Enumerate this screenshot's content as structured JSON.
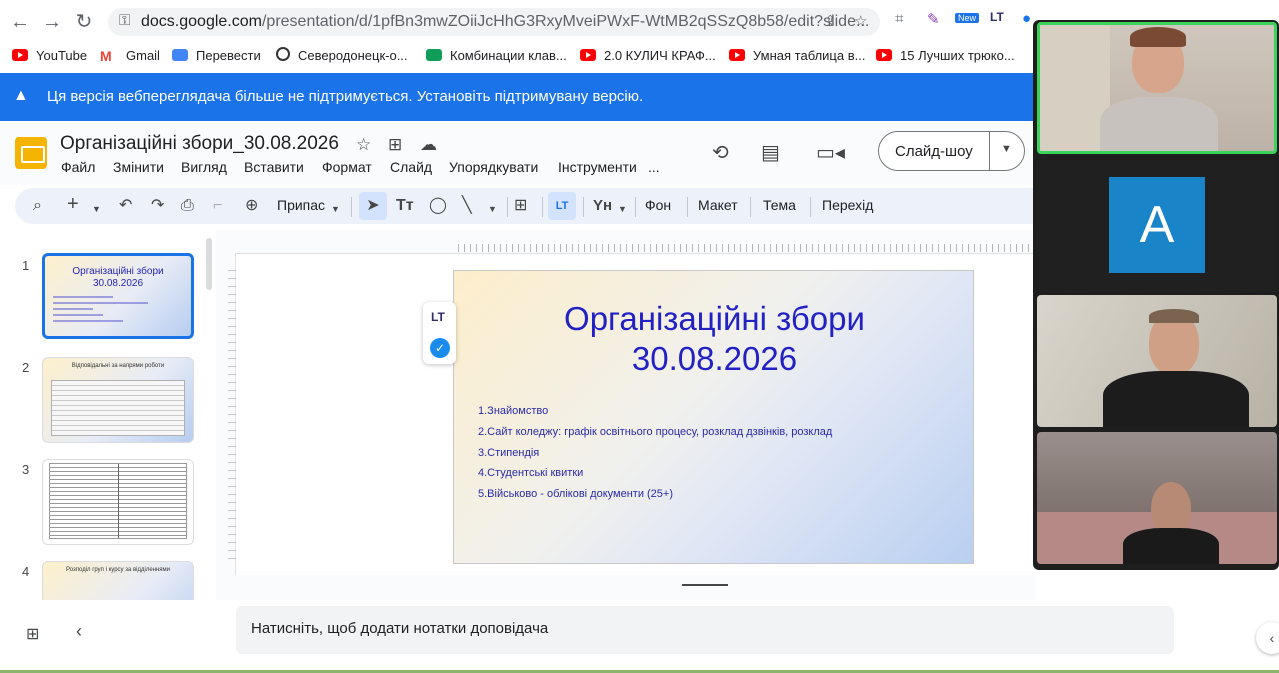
{
  "browser": {
    "url_host": "docs.google.com",
    "url_path": "/presentation/d/1pfBn3mwZOiiJcHhG3RxyMveiPWxF-WtMB2qSSzQ8b58/edit?slide...",
    "new_badge": "New",
    "lt_ext_label": "LT"
  },
  "bookmarks": [
    {
      "label": "YouTube",
      "icon": "youtube-icon"
    },
    {
      "label": "Gmail",
      "icon": "gmail-icon"
    },
    {
      "label": "Перевести",
      "icon": "translate-icon"
    },
    {
      "label": "Северодонецк-о...",
      "icon": "site-icon"
    },
    {
      "label": "Комбинации клав...",
      "icon": "bookmark-icon"
    },
    {
      "label": "2.0 КУЛИЧ КРАФ...",
      "icon": "youtube-icon"
    },
    {
      "label": "Умная таблица в...",
      "icon": "youtube-icon"
    },
    {
      "label": "15 Лучших трюко...",
      "icon": "youtube-icon"
    }
  ],
  "banner": {
    "text": "Ця версія веб­переглядача більше не підтримується. Установіть підтримувану версію.",
    "color": "#1a73e8"
  },
  "app": {
    "title": "Організаційні збори_30.08.2026",
    "menus": [
      "Файл",
      "Змінити",
      "Вигляд",
      "Вставити",
      "Формат",
      "Слайд",
      "Упорядкувати",
      "Інструменти",
      "..."
    ],
    "slideshow_label": "Слайд-шоу"
  },
  "toolbar": {
    "zoom_label": "Припас",
    "background": "Фон",
    "layout": "Макет",
    "theme": "Тема",
    "transition": "Перехід",
    "lt_label": "LT",
    "yn_label": "Yн"
  },
  "filmstrip": {
    "slides": [
      {
        "number": "1",
        "title": "Організаційні збори\n30.08.2026"
      },
      {
        "number": "2",
        "title": "Відповідальні за напрями роботи"
      },
      {
        "number": "3",
        "title": ""
      },
      {
        "number": "4",
        "title": "Розподіл груп і курсу за відділеннями"
      }
    ]
  },
  "slide": {
    "title_line1": "Організаційні збори",
    "title_line2": "30.08.2026",
    "items": [
      "1.Знайомство",
      "2.Сайт коледжу: графік освітнього процесу, розклад дзвінків, розклад",
      "3.Стипендія",
      "4.Студентські квитки",
      "5.Військово - облікові документи (25+)"
    ],
    "title_color": "#2222c4"
  },
  "notes": {
    "placeholder": "Натисніть, щоб додати нотатки доповідача"
  },
  "call": {
    "avatar_letter": "A",
    "active_speaker_color": "#3bd45a"
  }
}
